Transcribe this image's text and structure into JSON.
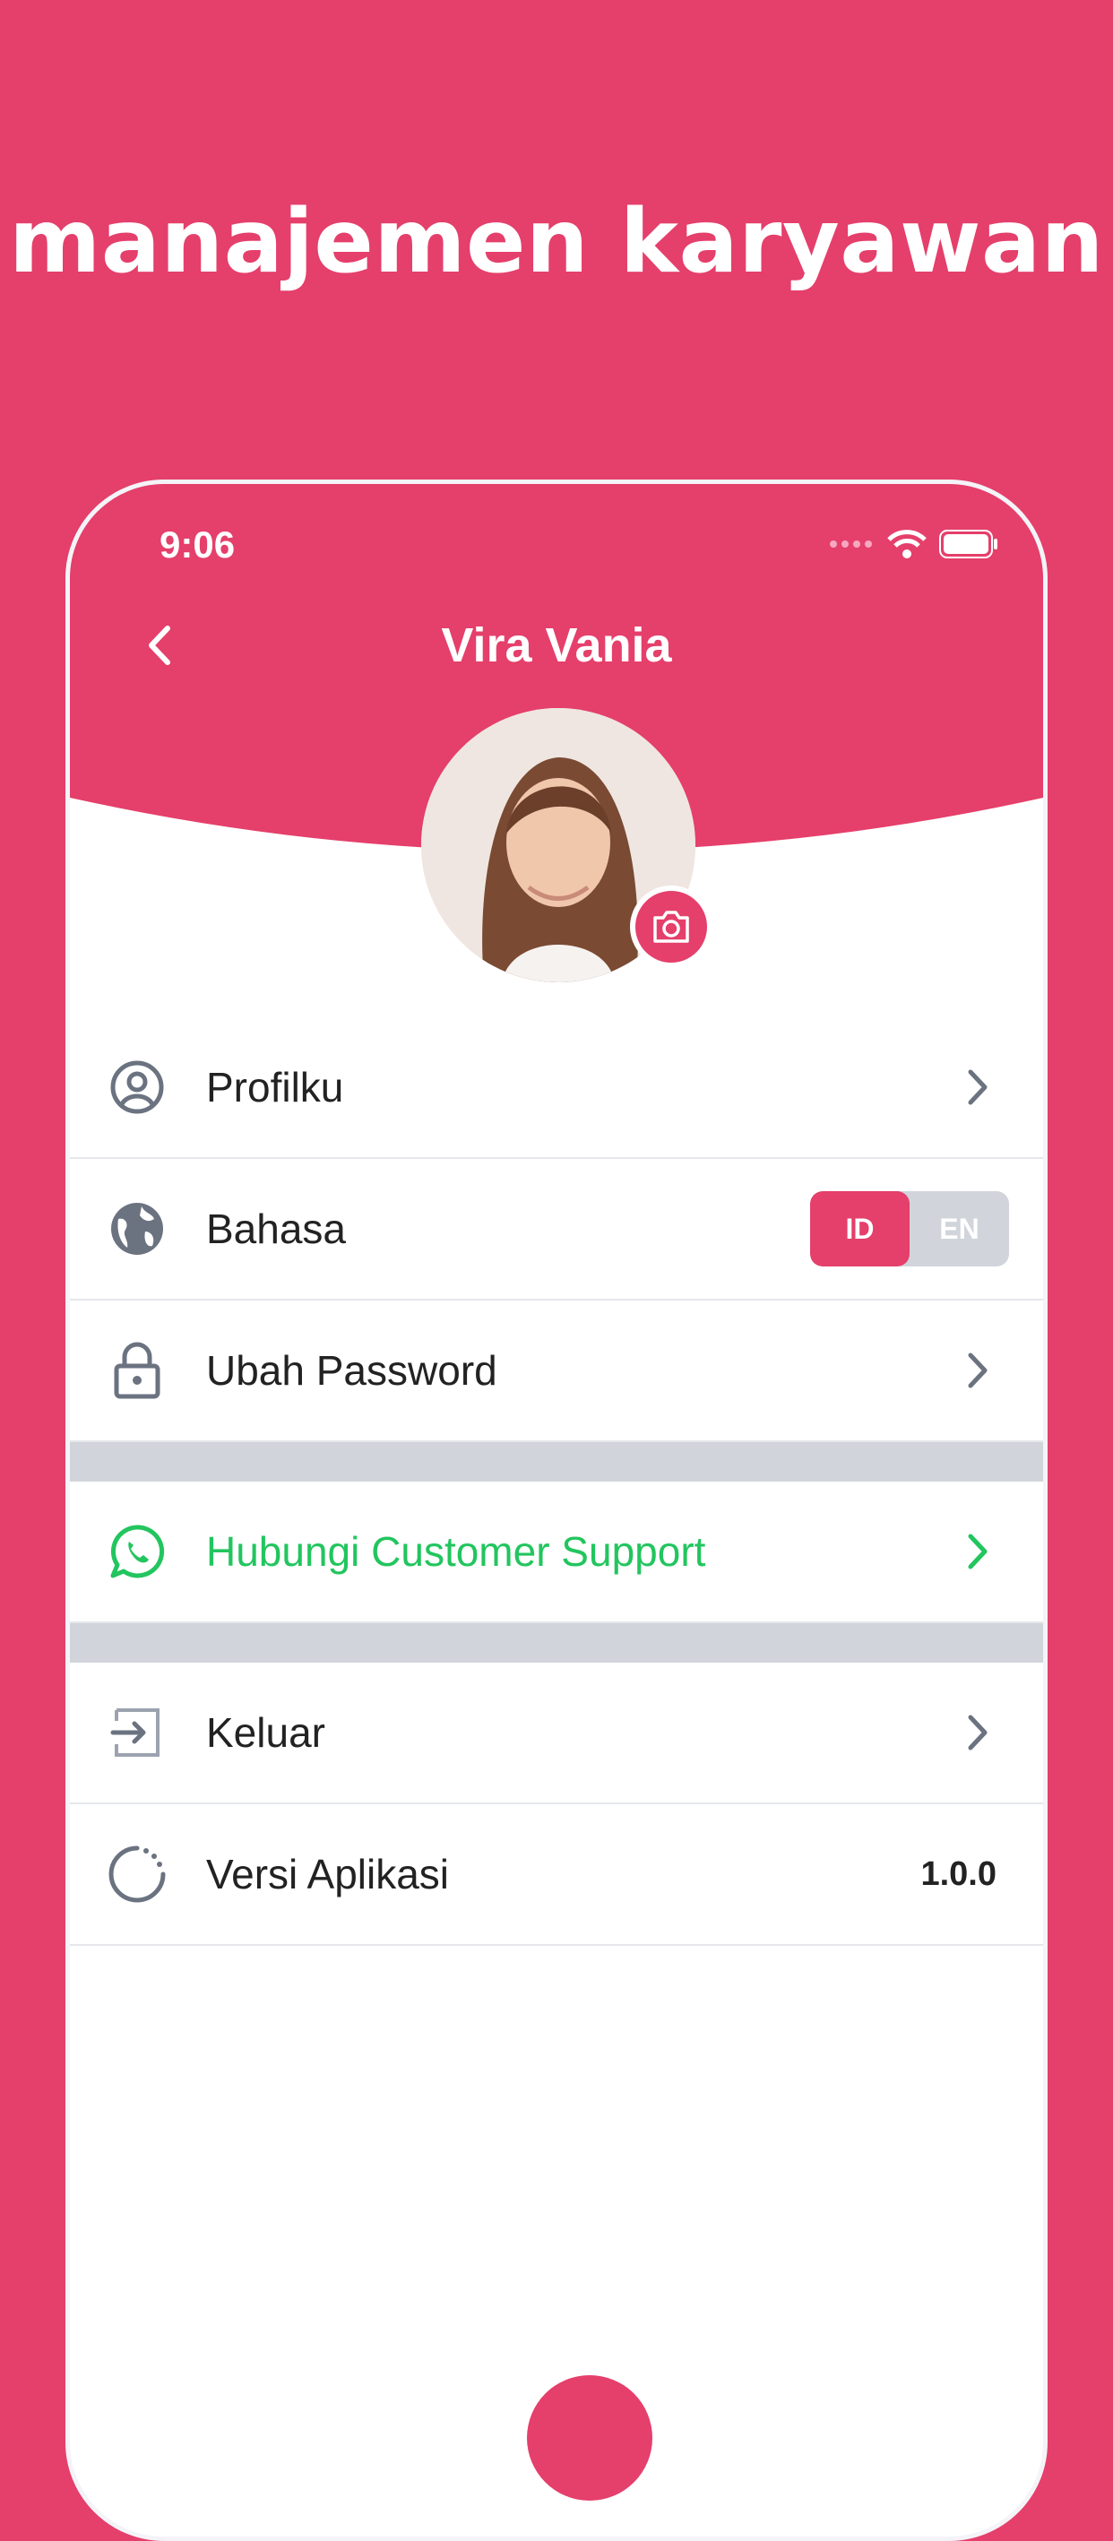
{
  "headline": "manajemen karyawan",
  "status": {
    "time": "9:06"
  },
  "header": {
    "title": "Vira Vania"
  },
  "colors": {
    "brand": "#e53f6b",
    "support": "#22c55e",
    "divider": "#d1d5db"
  },
  "menu": {
    "profile": {
      "label": "Profilku",
      "icon": "user-circle-icon"
    },
    "language": {
      "label": "Bahasa",
      "icon": "globe-icon",
      "options": [
        "ID",
        "EN"
      ],
      "selected": "ID"
    },
    "password": {
      "label": "Ubah Password",
      "icon": "lock-icon"
    },
    "support": {
      "label": "Hubungi Customer Support",
      "icon": "whatsapp-icon"
    },
    "logout": {
      "label": "Keluar",
      "icon": "logout-icon"
    },
    "version": {
      "label": "Versi Aplikasi",
      "icon": "loader-icon",
      "value": "1.0.0"
    }
  }
}
